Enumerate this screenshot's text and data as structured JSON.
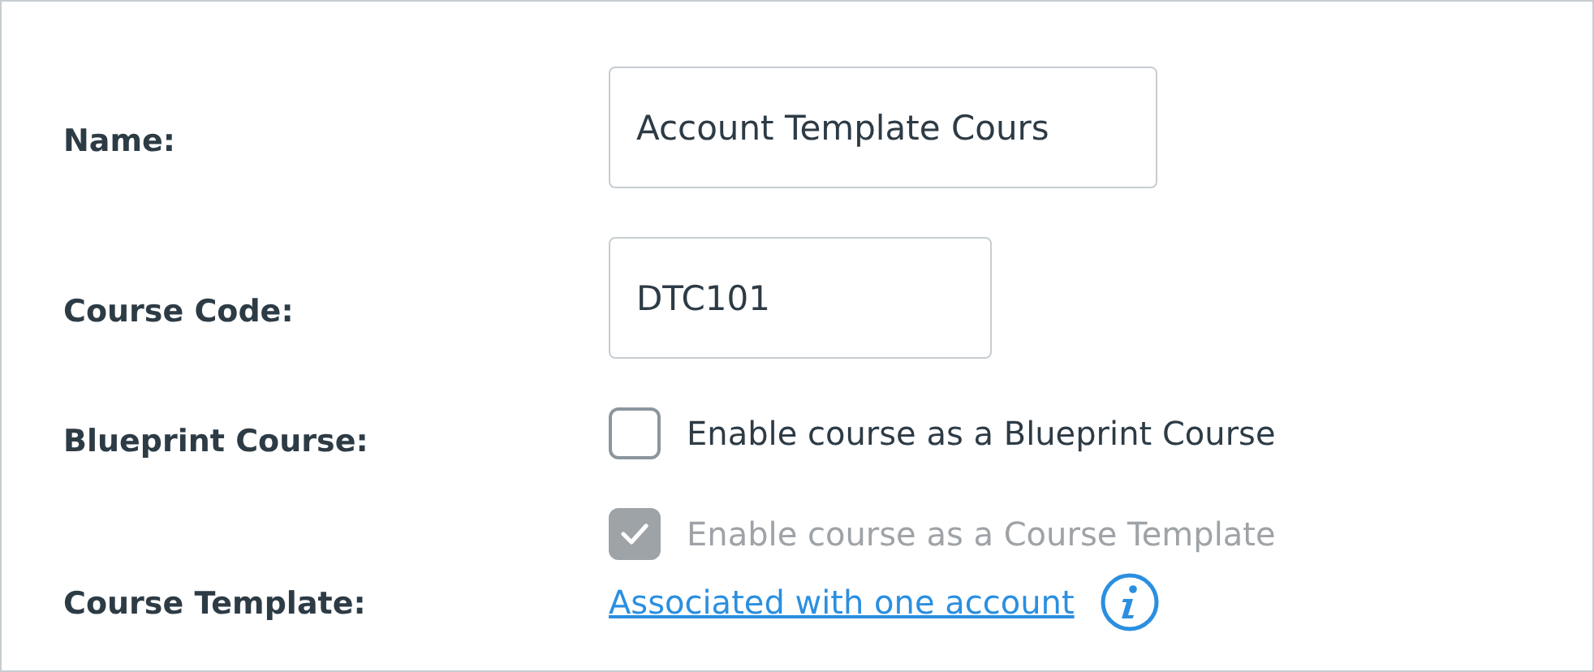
{
  "fields": [
    {
      "kind": "text",
      "label": "Name:",
      "value": "Account Template Cours"
    },
    {
      "kind": "text",
      "label": "Course Code:",
      "value": "DTC101"
    },
    {
      "kind": "checkbox",
      "label": "Blueprint Course:",
      "option": "Enable course as a Blueprint Course",
      "checked": false,
      "disabled": false
    },
    {
      "kind": "checkbox",
      "label": "Course Template:",
      "option": "Enable course as a Course Template",
      "checked": true,
      "disabled": true,
      "link": "Associated with one account"
    }
  ]
}
